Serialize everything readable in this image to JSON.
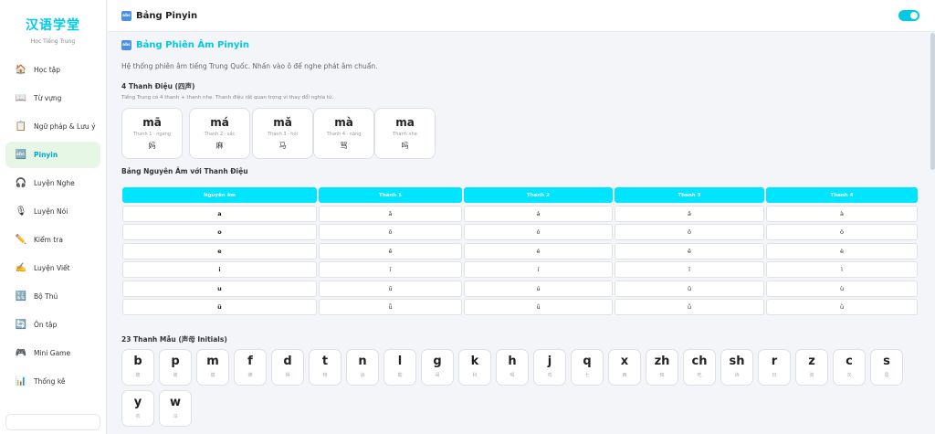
{
  "brand": {
    "title": "汉语学堂",
    "subtitle": "Học Tiếng Trung"
  },
  "sidebar": {
    "items": [
      {
        "label": "Học tập",
        "icon": "house-icon",
        "glyph": "🏠",
        "active": false
      },
      {
        "label": "Từ vựng",
        "icon": "book-icon",
        "glyph": "📖",
        "active": false
      },
      {
        "label": "Ngữ pháp & Lưu ý",
        "icon": "note-icon",
        "glyph": "📋",
        "active": false
      },
      {
        "label": "Pinyin",
        "icon": "abc-icon",
        "glyph": "🔤",
        "active": true
      },
      {
        "label": "Luyện Nghe",
        "icon": "headphones-icon",
        "glyph": "🎧",
        "active": false
      },
      {
        "label": "Luyện Nói",
        "icon": "microphone-icon",
        "glyph": "🎙",
        "active": false
      },
      {
        "label": "Kiểm tra",
        "icon": "pencil-icon",
        "glyph": "✏️",
        "active": false
      },
      {
        "label": "Luyện Viết",
        "icon": "writing-hand-icon",
        "glyph": "✍️",
        "active": false
      },
      {
        "label": "Bộ Thủ",
        "icon": "radical-icon",
        "glyph": "🔣",
        "active": false
      },
      {
        "label": "Ôn tập",
        "icon": "refresh-icon",
        "glyph": "🔄",
        "active": false
      },
      {
        "label": "Mini Game",
        "icon": "gamepad-icon",
        "glyph": "🎮",
        "active": false
      },
      {
        "label": "Thống kê",
        "icon": "stats-icon",
        "glyph": "📊",
        "active": false
      }
    ]
  },
  "header": {
    "title": "Bảng Pinyin",
    "icon_text": "abc",
    "toggle_on": true
  },
  "main": {
    "title": "Bảng Phiên Âm Pinyin",
    "description": "Hệ thống phiên âm tiếng Trung Quốc. Nhấn vào ô để nghe phát âm chuẩn.",
    "tones_heading": "4 Thanh Điệu (四声)",
    "tones_note": "Tiếng Trung có 4 thanh + thanh nhẹ. Thanh điệu rất quan trọng vì thay đổi nghĩa từ.",
    "tones": [
      {
        "pinyin": "mā",
        "name": "Thanh 1 · ngang",
        "hanzi": "妈"
      },
      {
        "pinyin": "má",
        "name": "Thanh 2 · sắc",
        "hanzi": "麻"
      },
      {
        "pinyin": "mǎ",
        "name": "Thanh 3 · hỏi",
        "hanzi": "马"
      },
      {
        "pinyin": "mà",
        "name": "Thanh 4 · nặng",
        "hanzi": "骂"
      },
      {
        "pinyin": "ma",
        "name": "Thanh nhẹ",
        "hanzi": "吗"
      }
    ],
    "vowel_heading": "Bảng Nguyên Âm với Thanh Điệu",
    "vowel_table": {
      "headers": [
        "Nguyên âm",
        "Thanh 1",
        "Thanh 2",
        "Thanh 3",
        "Thanh 4"
      ],
      "rows": [
        [
          "a",
          "ā",
          "á",
          "ǎ",
          "à"
        ],
        [
          "o",
          "ō",
          "ó",
          "ǒ",
          "ò"
        ],
        [
          "e",
          "ē",
          "é",
          "ě",
          "è"
        ],
        [
          "i",
          "ī",
          "í",
          "ǐ",
          "ì"
        ],
        [
          "u",
          "ū",
          "ú",
          "ǔ",
          "ù"
        ],
        [
          "ü",
          "ǖ",
          "ǘ",
          "ǚ",
          "ǜ"
        ]
      ]
    },
    "initials_heading": "23 Thanh Mẫu (声母 Initials)",
    "initials": [
      {
        "letter": "b",
        "hanzi": "玻"
      },
      {
        "letter": "p",
        "hanzi": "坡"
      },
      {
        "letter": "m",
        "hanzi": "摸"
      },
      {
        "letter": "f",
        "hanzi": "佛"
      },
      {
        "letter": "d",
        "hanzi": "得"
      },
      {
        "letter": "t",
        "hanzi": "特"
      },
      {
        "letter": "n",
        "hanzi": "讷"
      },
      {
        "letter": "l",
        "hanzi": "勒"
      },
      {
        "letter": "g",
        "hanzi": "哥"
      },
      {
        "letter": "k",
        "hanzi": "科"
      },
      {
        "letter": "h",
        "hanzi": "喝"
      },
      {
        "letter": "j",
        "hanzi": "鸡"
      },
      {
        "letter": "q",
        "hanzi": "七"
      },
      {
        "letter": "x",
        "hanzi": "西"
      },
      {
        "letter": "zh",
        "hanzi": "知"
      },
      {
        "letter": "ch",
        "hanzi": "吃"
      },
      {
        "letter": "sh",
        "hanzi": "诗"
      },
      {
        "letter": "r",
        "hanzi": "日"
      },
      {
        "letter": "z",
        "hanzi": "资"
      },
      {
        "letter": "c",
        "hanzi": "次"
      },
      {
        "letter": "s",
        "hanzi": "思"
      },
      {
        "letter": "y",
        "hanzi": "衣"
      },
      {
        "letter": "w",
        "hanzi": "乌"
      }
    ]
  },
  "colors": {
    "accent": "#00c9e6",
    "table_header": "#00e5ff",
    "active_bg": "#e6f7e6"
  }
}
